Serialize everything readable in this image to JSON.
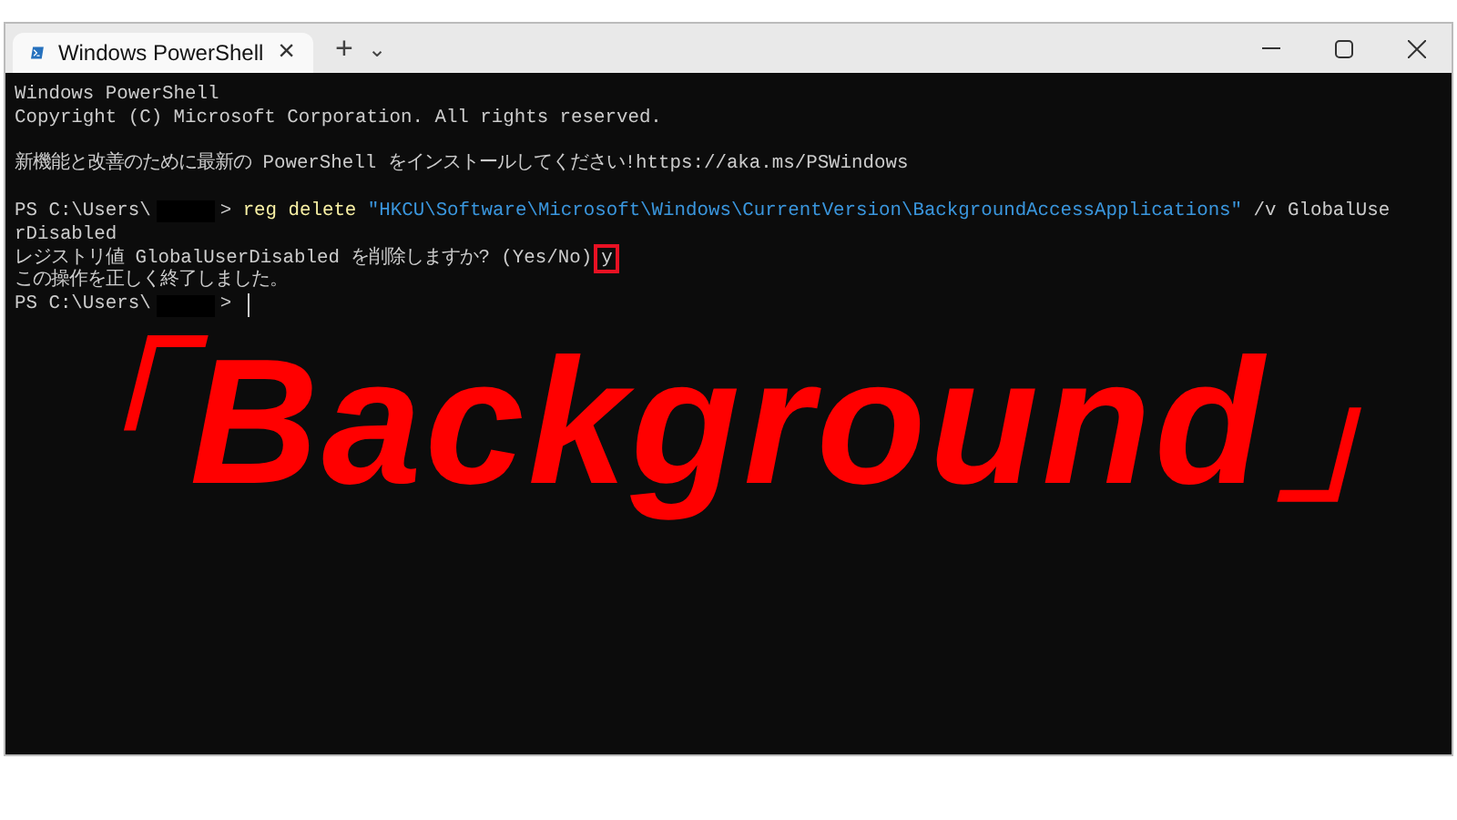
{
  "window": {
    "tabs": [
      {
        "title": "Windows PowerShell",
        "selected": true,
        "close": "×"
      }
    ],
    "new_tab": "+",
    "dropdown": "⌄"
  },
  "terminal": {
    "lines": [
      {
        "kind": "output",
        "segments": [
          {
            "kind": "text",
            "text": "Windows PowerShell"
          }
        ]
      },
      {
        "kind": "output",
        "segments": [
          {
            "kind": "text",
            "text": "Copyright (C) Microsoft Corporation. All rights reserved."
          }
        ]
      },
      {
        "kind": "blank"
      },
      {
        "kind": "output",
        "segments": [
          {
            "kind": "text",
            "text": "新機能と改善のために最新の PowerShell をインストールしてください!https://aka.ms/PSWindows"
          }
        ]
      },
      {
        "kind": "blank"
      },
      {
        "kind": "output",
        "segments": [
          {
            "kind": "text",
            "text": "PS C:\\Users\\"
          },
          {
            "kind": "redacted"
          },
          {
            "kind": "text",
            "text": "> "
          },
          {
            "kind": "command",
            "text": "reg delete"
          },
          {
            "kind": "string",
            "text": " \"HKCU\\Software\\Microsoft\\Windows\\CurrentVersion\\BackgroundAccessApplications\""
          },
          {
            "kind": "text",
            "text": " /v GlobalUse"
          }
        ]
      },
      {
        "kind": "output",
        "segments": [
          {
            "kind": "text",
            "text": "rDisabled"
          }
        ]
      },
      {
        "kind": "output",
        "segments": [
          {
            "kind": "text",
            "text": "レジストリ値 GlobalUserDisabled を削除しますか? (Yes/No)"
          },
          {
            "kind": "highlighted",
            "text": "y"
          }
        ]
      },
      {
        "kind": "output",
        "segments": [
          {
            "kind": "text",
            "text": "この操作を正しく終了しました。"
          }
        ]
      },
      {
        "kind": "output",
        "segments": [
          {
            "kind": "text",
            "text": "PS C:\\Users\\"
          },
          {
            "kind": "redacted"
          },
          {
            "kind": "text",
            "text": "> "
          },
          {
            "kind": "cursor"
          }
        ]
      }
    ]
  },
  "overlay_caption": "「Background」"
}
